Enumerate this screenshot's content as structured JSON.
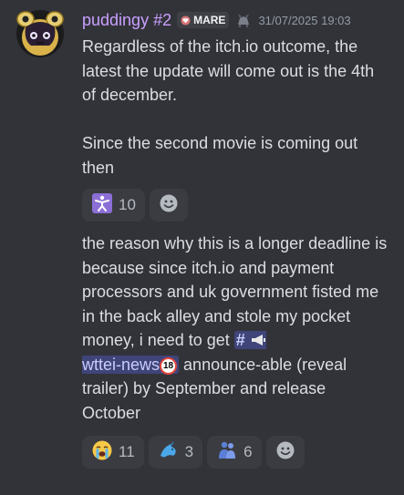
{
  "message": {
    "author": "puddingy #2",
    "tag_label": "MARE",
    "timestamp": "31/07/2025 19:03",
    "text_1a": "Regardless of the itch.io outcome, the latest the update will come out is the 4th of december.",
    "text_1b": "Since the second movie is coming out then",
    "text_2_before": "the reason why this is a longer deadline is because since itch.io and payment processors and uk government fisted me in the back alley and stole my pocket money, i need to get",
    "channel_name": "wttei-news",
    "channel_badge": "18",
    "text_2_after": "announce-able (reveal trailer) by September and release October"
  },
  "reactions_1": [
    {
      "icon": "stick-figure-dance-emoji",
      "count": "10"
    }
  ],
  "reactions_2": [
    {
      "icon": "loudly-crying-face-emoji",
      "count": "11"
    },
    {
      "icon": "dolphin-emoji",
      "count": "3"
    },
    {
      "icon": "hugging-figures-emoji",
      "count": "6"
    }
  ],
  "colors": {
    "background": "#323339",
    "username": "#c9a0ff",
    "reaction_bg": "#3b3c42",
    "channel_mention_bg": "#3d4370"
  }
}
